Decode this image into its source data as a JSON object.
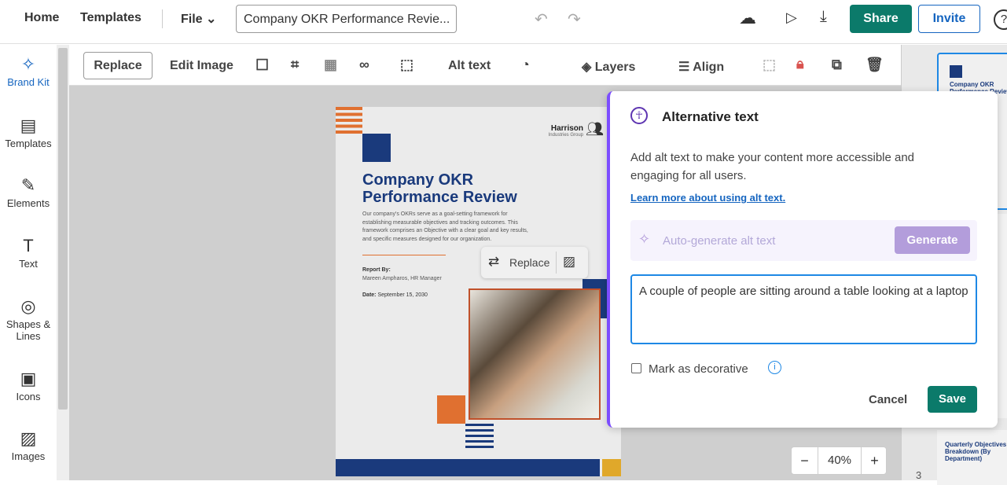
{
  "topbar": {
    "home": "Home",
    "templates": "Templates",
    "file": "File",
    "doc_title": "Company OKR Performance Revie...",
    "share": "Share",
    "invite": "Invite"
  },
  "sidebar": {
    "items": [
      {
        "label": "Brand Kit",
        "icon": "magic-wand-icon"
      },
      {
        "label": "Templates",
        "icon": "templates-icon"
      },
      {
        "label": "Elements",
        "icon": "elements-icon"
      },
      {
        "label": "Text",
        "icon": "text-icon"
      },
      {
        "label": "Shapes & Lines",
        "icon": "shapes-icon"
      },
      {
        "label": "Icons",
        "icon": "briefcase-icon"
      },
      {
        "label": "Images",
        "icon": "image-icon"
      }
    ]
  },
  "toolbar": {
    "replace": "Replace",
    "edit_image": "Edit Image",
    "alt_text": "Alt text",
    "layers": "Layers",
    "align": "Align"
  },
  "page": {
    "company": "Harrison",
    "company_sub": "Industries Group",
    "title_1": "Company OKR",
    "title_2": "Performance Review",
    "body": "Our company's OKRs serve as a goal-setting framework for establishing measurable objectives and tracking outcomes. This framework comprises an Objective with a clear goal and key results, and specific measures designed for our organization.",
    "report_by_label": "Report By:",
    "report_by": "Mareen Ampharos, HR Manager",
    "date_label": "Date:",
    "date": "September 15, 2030",
    "replace_popup": "Replace"
  },
  "zoom": {
    "minus": "−",
    "value": "40%",
    "plus": "+"
  },
  "thumbs": {
    "title1": "Company OKR Performance Review",
    "title2": "Quarterly Objectives Breakdown (By Department)",
    "page_num": "3"
  },
  "dialog": {
    "title": "Alternative text",
    "desc": "Add alt text to make your content more accessible and engaging for all users.",
    "learn_more": "Learn more about using alt text.",
    "autogen_placeholder": "Auto-generate alt text",
    "generate": "Generate",
    "alt_value": "A couple of people are sitting around a table looking at a laptop",
    "decorative": "Mark as decorative",
    "cancel": "Cancel",
    "save": "Save"
  },
  "colors": {
    "accent": "#0b7a6a",
    "navy": "#1a3a7c",
    "orange": "#e07030",
    "purple": "#7c4dff"
  }
}
